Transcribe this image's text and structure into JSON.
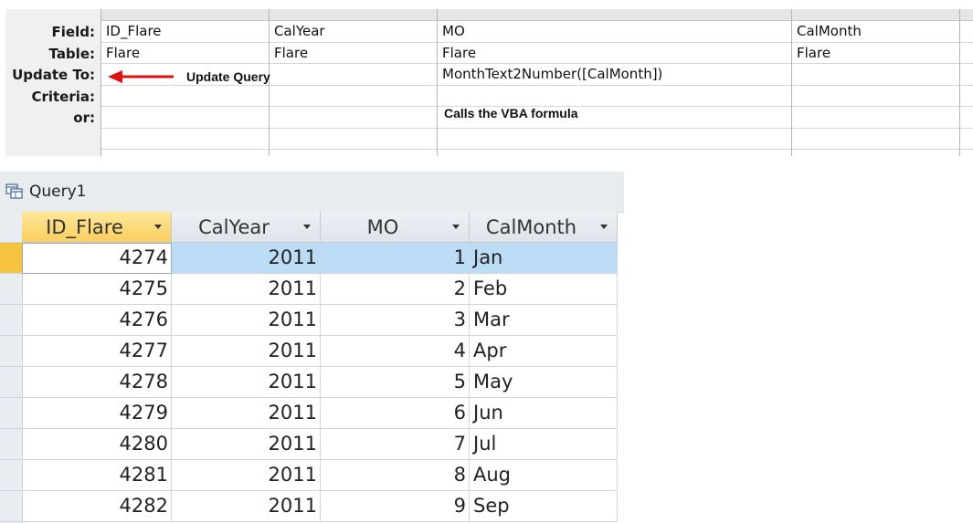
{
  "design": {
    "row_labels": [
      "Field:",
      "Table:",
      "Update To:",
      "Criteria:",
      "or:"
    ],
    "columns": [
      {
        "field": "ID_Flare",
        "table": "Flare",
        "update_to": ""
      },
      {
        "field": "CalYear",
        "table": "Flare",
        "update_to": ""
      },
      {
        "field": "MO",
        "table": "Flare",
        "update_to": "MonthText2Number([CalMonth])"
      },
      {
        "field": "CalMonth",
        "table": "Flare",
        "update_to": ""
      },
      {
        "field": "",
        "table": "",
        "update_to": ""
      }
    ],
    "annotation_update": "Update Query",
    "annotation_vba": "Calls the VBA formula",
    "arrow_color": "#e01010"
  },
  "datasheet": {
    "tab_title": "Query1",
    "tab_icon": "query-icon",
    "headers": [
      "ID_Flare",
      "CalYear",
      "MO",
      "CalMonth"
    ],
    "rows": [
      [
        "4274",
        "2011",
        "1",
        "Jan"
      ],
      [
        "4275",
        "2011",
        "2",
        "Feb"
      ],
      [
        "4276",
        "2011",
        "3",
        "Mar"
      ],
      [
        "4277",
        "2011",
        "4",
        "Apr"
      ],
      [
        "4278",
        "2011",
        "5",
        "May"
      ],
      [
        "4279",
        "2011",
        "6",
        "Jun"
      ],
      [
        "4280",
        "2011",
        "7",
        "Jul"
      ],
      [
        "4281",
        "2011",
        "8",
        "Aug"
      ],
      [
        "4282",
        "2011",
        "9",
        "Sep"
      ]
    ],
    "selected_row": 0,
    "selection_color": "#bcdcf6",
    "active_header_color": "#f9cf5e"
  }
}
